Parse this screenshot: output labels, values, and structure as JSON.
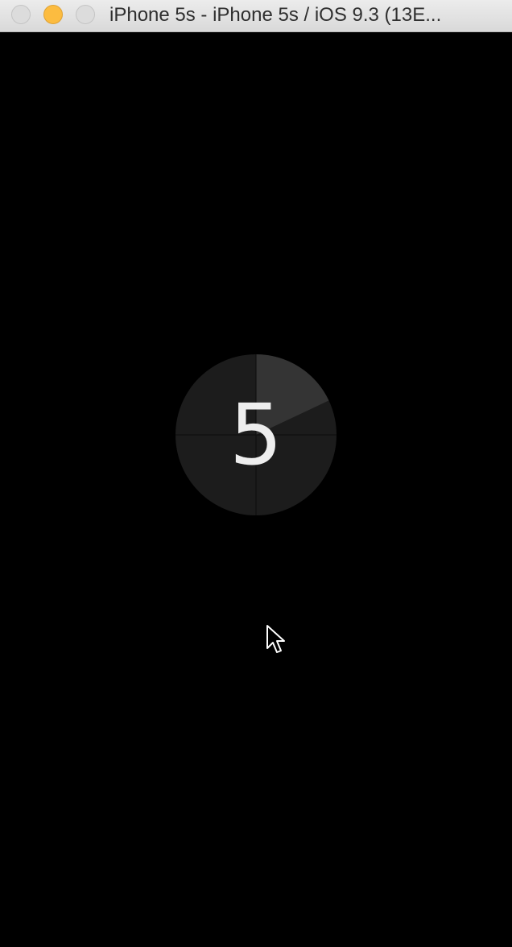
{
  "window": {
    "title": "iPhone 5s - iPhone 5s / iOS 9.3 (13E...",
    "buttons": {
      "close": "close-button",
      "minimize": "minimize-button",
      "zoom": "zoom-button"
    }
  },
  "countdown": {
    "value": "5",
    "progress_fraction": 0.18,
    "colors": {
      "background": "#1c1c1c",
      "elapsed": "#343434",
      "crosshair": "#0d0d0d",
      "digit": "#eeeeee"
    }
  },
  "colors": {
    "screen_background": "#000000",
    "titlebar": "#e3e3e3",
    "minimize_button": "#fcbc40"
  }
}
